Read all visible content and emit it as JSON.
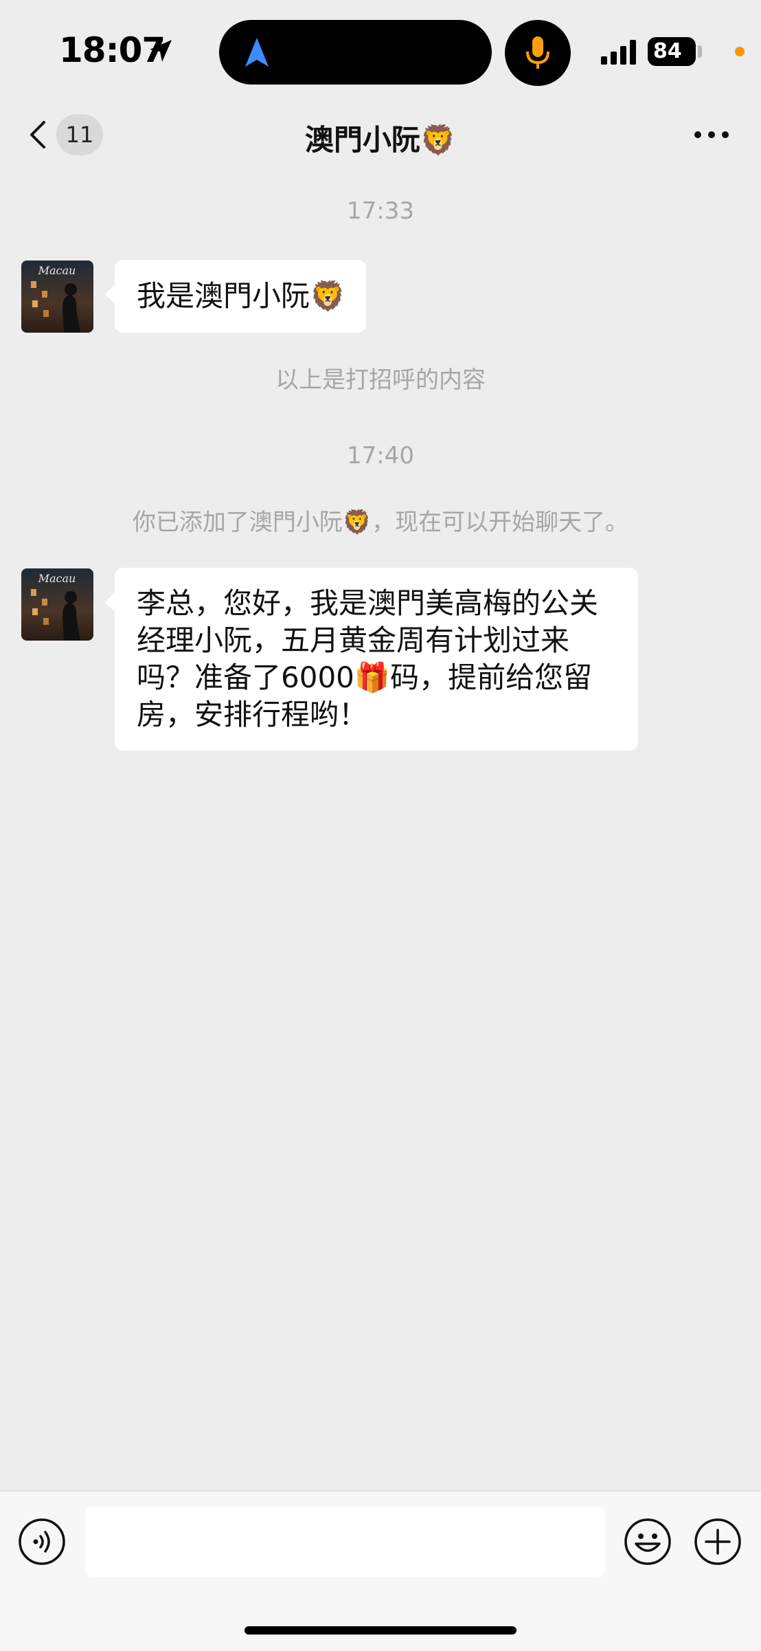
{
  "status_bar": {
    "time": "18:07",
    "battery": "84"
  },
  "header": {
    "back_badge": "11",
    "title": "澳門小阮🦁"
  },
  "chat": {
    "timestamp_1": "17:33",
    "message_1": "我是澳門小阮🦁",
    "system_greeting": "以上是打招呼的内容",
    "timestamp_2": "17:40",
    "system_added": "你已添加了澳門小阮🦁，现在可以开始聊天了。",
    "message_2": "李总，您好，我是澳門美高梅的公关经理小阮，五月黄金周有计划过来吗？准备了6000🎁码，提前给您留房，安排行程哟！",
    "avatar_text": "Macau"
  },
  "input_bar": {
    "value": ""
  },
  "colors": {
    "background": "#ededed",
    "bubble": "#ffffff",
    "muted_text": "#a6a6a6",
    "island_nav_blue": "#3d8bff",
    "mic_orange": "#ff9f0a",
    "privacy_dot": "#ff9500"
  },
  "icons": [
    "location-arrow-icon",
    "navigation-arrow-icon",
    "microphone-icon",
    "signal-icon",
    "chevron-left-icon",
    "more-dots-icon",
    "voice-icon",
    "emoji-icon",
    "plus-icon"
  ]
}
